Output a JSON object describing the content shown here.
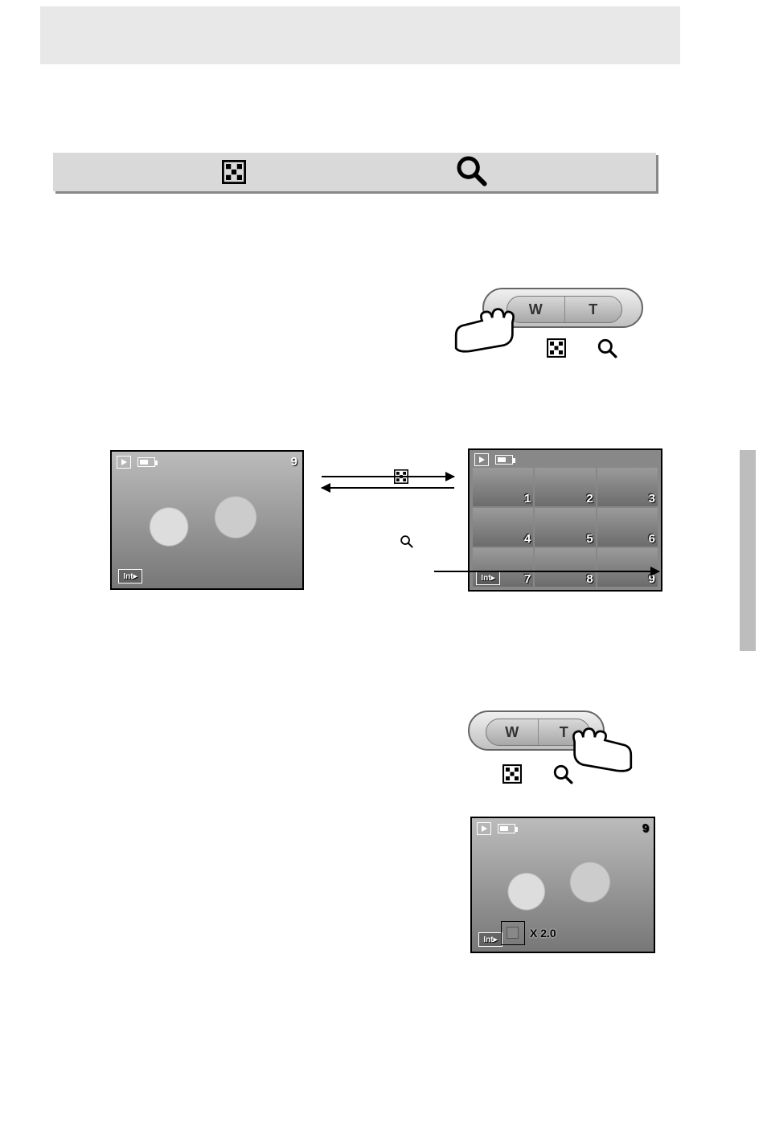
{
  "wt": {
    "w": "W",
    "t": "T"
  },
  "single_screen": {
    "number": "9",
    "int": "Int▸"
  },
  "grid_screen": {
    "int": "Int▸",
    "cells": [
      "1",
      "2",
      "3",
      "4",
      "5",
      "6",
      "7",
      "8",
      "9"
    ]
  },
  "zoom_screen": {
    "number": "9",
    "int": "Int▸",
    "zoom": "X 2.0"
  }
}
